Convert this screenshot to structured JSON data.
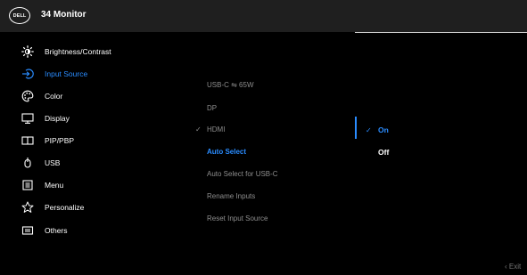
{
  "header": {
    "logo_text": "DELL",
    "title": "34 Monitor"
  },
  "menu": {
    "items": [
      {
        "label": "Brightness/Contrast",
        "icon": "brightness-icon"
      },
      {
        "label": "Input Source",
        "icon": "input-source-icon"
      },
      {
        "label": "Color",
        "icon": "color-palette-icon"
      },
      {
        "label": "Display",
        "icon": "display-monitor-icon"
      },
      {
        "label": "PIP/PBP",
        "icon": "pip-pbp-icon"
      },
      {
        "label": "USB",
        "icon": "usb-power-icon"
      },
      {
        "label": "Menu",
        "icon": "menu-icon"
      },
      {
        "label": "Personalize",
        "icon": "star-icon"
      },
      {
        "label": "Others",
        "icon": "others-icon"
      }
    ],
    "active_item": "Input Source"
  },
  "input_source": {
    "options": [
      {
        "label": "USB-C ⇋ 65W"
      },
      {
        "label": "DP"
      },
      {
        "label": "HDMI",
        "selected": true
      },
      {
        "label": "Auto Select",
        "highlighted": true
      },
      {
        "label": "Auto Select for USB-C"
      },
      {
        "label": "Rename Inputs"
      },
      {
        "label": "Reset Input Source"
      }
    ]
  },
  "auto_select": {
    "options": [
      {
        "label": "On",
        "selected": true
      },
      {
        "label": "Off"
      }
    ]
  },
  "footer": {
    "exit_label": "Exit"
  },
  "colors": {
    "accent": "#2a8cff",
    "header_bg": "#1f1f1f",
    "background": "#000000",
    "inactive_text": "#8d8d8d"
  }
}
